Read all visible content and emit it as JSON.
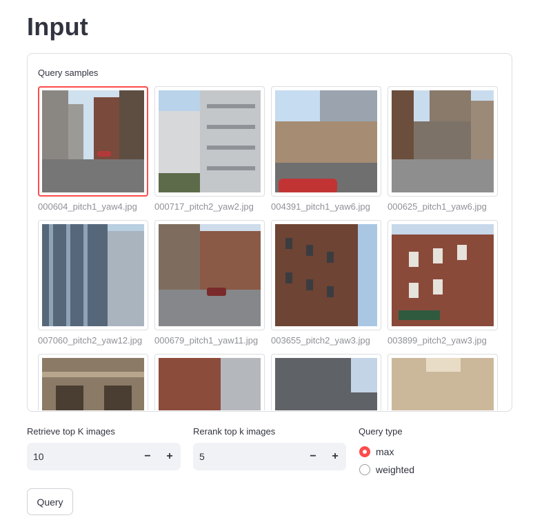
{
  "page": {
    "title": "Input"
  },
  "gallery": {
    "label": "Query samples",
    "items": [
      {
        "caption": "000604_pitch1_yaw4.jpg",
        "selected": true
      },
      {
        "caption": "000717_pitch2_yaw2.jpg",
        "selected": false
      },
      {
        "caption": "004391_pitch1_yaw6.jpg",
        "selected": false
      },
      {
        "caption": "000625_pitch1_yaw6.jpg",
        "selected": false
      },
      {
        "caption": "007060_pitch2_yaw12.jpg",
        "selected": false
      },
      {
        "caption": "000679_pitch1_yaw11.jpg",
        "selected": false
      },
      {
        "caption": "003655_pitch2_yaw3.jpg",
        "selected": false
      },
      {
        "caption": "003899_pitch2_yaw3.jpg",
        "selected": false
      },
      {
        "caption": "",
        "selected": false
      },
      {
        "caption": "",
        "selected": false
      },
      {
        "caption": "",
        "selected": false
      },
      {
        "caption": "",
        "selected": false
      }
    ]
  },
  "retrieve": {
    "label": "Retrieve top K images",
    "value": "10",
    "minus": "−",
    "plus": "+"
  },
  "rerank": {
    "label": "Rerank top k images",
    "value": "5",
    "minus": "−",
    "plus": "+"
  },
  "query_type": {
    "label": "Query type",
    "options": [
      {
        "label": "max",
        "checked": true
      },
      {
        "label": "weighted",
        "checked": false
      }
    ]
  },
  "query_button": {
    "label": "Query"
  },
  "colors": {
    "accent": "#ff4b4b",
    "text": "#31333f",
    "caption": "#8f9097",
    "input_bg": "#f0f2f6"
  }
}
